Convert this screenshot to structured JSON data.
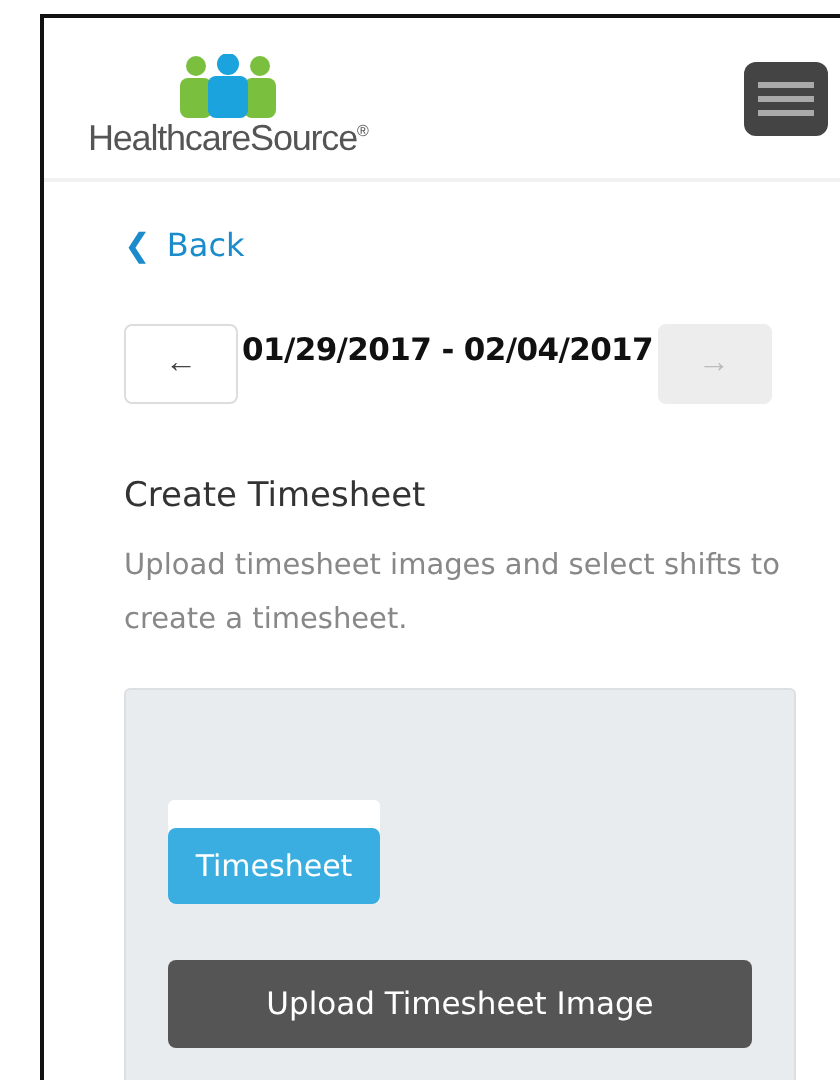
{
  "header": {
    "logo": "HealthcareSource$^{®}$"
  },
  "back_link": {
    "icon": "❮",
    "label": "Back"
  },
  "date_nav": {
    "range": "01/29/2017 - 02/04/2017",
    "buttons": [
      {
        "kind": "prev",
        "icon": "←",
        "disabled": false
      },
      {
        "kind": "next",
        "icon": "→",
        "disabled": true
      }
    ]
  },
  "section": {
    "title": "Create Timesheet",
    "description": "Upload timesheet images and select shifts to create a timesheet."
  },
  "upload_panel": {
    "thumbnail_label": "Timesheet",
    "button": "Upload Timesheet Image"
  }
}
